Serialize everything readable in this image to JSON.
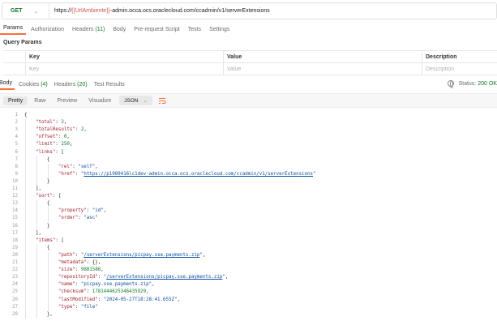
{
  "request": {
    "method": "GET",
    "url_prefix": "https://",
    "url_variable": "{{UrlAmbiente}}",
    "url_suffix": "-admin.occa.ocs.oraclecloud.com/ccadmin/v1/serverExtensions"
  },
  "request_tabs": [
    {
      "label": "Params",
      "active": true
    },
    {
      "label": "Authorization"
    },
    {
      "label": "Headers",
      "count": "(11)"
    },
    {
      "label": "Body"
    },
    {
      "label": "Pre-request Script"
    },
    {
      "label": "Tests"
    },
    {
      "label": "Settings"
    }
  ],
  "query_params": {
    "title": "Query Params",
    "headers": {
      "key": "Key",
      "value": "Value",
      "description": "Description"
    },
    "placeholders": {
      "key": "Key",
      "value": "Value",
      "description": "Description"
    }
  },
  "response_tabs": [
    {
      "label": "Body",
      "active": true
    },
    {
      "label": "Cookies",
      "count": "(4)"
    },
    {
      "label": "Headers",
      "count": "(20)"
    },
    {
      "label": "Test Results"
    }
  ],
  "status": {
    "label": "Status:",
    "code": "200 OK"
  },
  "view_buttons": [
    {
      "label": "Pretty",
      "active": true
    },
    {
      "label": "Raw"
    },
    {
      "label": "Preview"
    },
    {
      "label": "Visualize"
    }
  ],
  "format": "JSON",
  "code_lines": [
    [
      {
        "t": "{",
        "c": "p"
      }
    ],
    [
      {
        "t": "    ",
        "c": "p"
      },
      {
        "t": "\"total\"",
        "c": "k"
      },
      {
        "t": ": ",
        "c": "p"
      },
      {
        "t": "2",
        "c": "n"
      },
      {
        "t": ",",
        "c": "p"
      }
    ],
    [
      {
        "t": "    ",
        "c": "p"
      },
      {
        "t": "\"totalResults\"",
        "c": "k"
      },
      {
        "t": ": ",
        "c": "p"
      },
      {
        "t": "2",
        "c": "n"
      },
      {
        "t": ",",
        "c": "p"
      }
    ],
    [
      {
        "t": "    ",
        "c": "p"
      },
      {
        "t": "\"offset\"",
        "c": "k"
      },
      {
        "t": ": ",
        "c": "p"
      },
      {
        "t": "0",
        "c": "n"
      },
      {
        "t": ",",
        "c": "p"
      }
    ],
    [
      {
        "t": "    ",
        "c": "p"
      },
      {
        "t": "\"limit\"",
        "c": "k"
      },
      {
        "t": ": ",
        "c": "p"
      },
      {
        "t": "250",
        "c": "n"
      },
      {
        "t": ",",
        "c": "p"
      }
    ],
    [
      {
        "t": "    ",
        "c": "p"
      },
      {
        "t": "\"links\"",
        "c": "k"
      },
      {
        "t": ": [",
        "c": "p"
      }
    ],
    [
      {
        "t": "        {",
        "c": "p"
      }
    ],
    [
      {
        "t": "            ",
        "c": "p"
      },
      {
        "t": "\"rel\"",
        "c": "k"
      },
      {
        "t": ": ",
        "c": "p"
      },
      {
        "t": "\"self\"",
        "c": "s"
      },
      {
        "t": ",",
        "c": "p"
      }
    ],
    [
      {
        "t": "            ",
        "c": "p"
      },
      {
        "t": "\"href\"",
        "c": "k"
      },
      {
        "t": ": ",
        "c": "p"
      },
      {
        "t": "\"",
        "c": "s"
      },
      {
        "t": "https://p1989416lc1dev-admin.occa.ocs.oraclecloud.com/ccadmin/v1/serverExtensions",
        "c": "u"
      },
      {
        "t": "\"",
        "c": "s"
      }
    ],
    [
      {
        "t": "        }",
        "c": "p"
      }
    ],
    [
      {
        "t": "    ],",
        "c": "p"
      }
    ],
    [
      {
        "t": "    ",
        "c": "p"
      },
      {
        "t": "\"sort\"",
        "c": "k"
      },
      {
        "t": ": [",
        "c": "p"
      }
    ],
    [
      {
        "t": "        {",
        "c": "p"
      }
    ],
    [
      {
        "t": "            ",
        "c": "p"
      },
      {
        "t": "\"property\"",
        "c": "k"
      },
      {
        "t": ": ",
        "c": "p"
      },
      {
        "t": "\"id\"",
        "c": "s"
      },
      {
        "t": ",",
        "c": "p"
      }
    ],
    [
      {
        "t": "            ",
        "c": "p"
      },
      {
        "t": "\"order\"",
        "c": "k"
      },
      {
        "t": ": ",
        "c": "p"
      },
      {
        "t": "\"asc\"",
        "c": "s"
      }
    ],
    [
      {
        "t": "        }",
        "c": "p"
      }
    ],
    [
      {
        "t": "    ],",
        "c": "p"
      }
    ],
    [
      {
        "t": "    ",
        "c": "p"
      },
      {
        "t": "\"items\"",
        "c": "k"
      },
      {
        "t": ": [",
        "c": "p"
      }
    ],
    [
      {
        "t": "        {",
        "c": "p"
      }
    ],
    [
      {
        "t": "            ",
        "c": "p"
      },
      {
        "t": "\"path\"",
        "c": "k"
      },
      {
        "t": ": ",
        "c": "p"
      },
      {
        "t": "\"",
        "c": "s"
      },
      {
        "t": "/serverExtensions/picpay.sse.payments.zip",
        "c": "u"
      },
      {
        "t": "\"",
        "c": "s"
      },
      {
        "t": ",",
        "c": "p"
      }
    ],
    [
      {
        "t": "            ",
        "c": "p"
      },
      {
        "t": "\"metadata\"",
        "c": "k"
      },
      {
        "t": ": {},",
        "c": "p"
      }
    ],
    [
      {
        "t": "            ",
        "c": "p"
      },
      {
        "t": "\"size\"",
        "c": "k"
      },
      {
        "t": ": ",
        "c": "p"
      },
      {
        "t": "9881586",
        "c": "n"
      },
      {
        "t": ",",
        "c": "p"
      }
    ],
    [
      {
        "t": "            ",
        "c": "p"
      },
      {
        "t": "\"repositoryId\"",
        "c": "k"
      },
      {
        "t": ": ",
        "c": "p"
      },
      {
        "t": "\"",
        "c": "s"
      },
      {
        "t": "/serverExtensions/picpay.sse.payments.zip",
        "c": "u"
      },
      {
        "t": "\"",
        "c": "s"
      },
      {
        "t": ",",
        "c": "p"
      }
    ],
    [
      {
        "t": "            ",
        "c": "p"
      },
      {
        "t": "\"name\"",
        "c": "k"
      },
      {
        "t": ": ",
        "c": "p"
      },
      {
        "t": "\"picpay.sse.payments.zip\"",
        "c": "s"
      },
      {
        "t": ",",
        "c": "p"
      }
    ],
    [
      {
        "t": "            ",
        "c": "p"
      },
      {
        "t": "\"checksum\"",
        "c": "k"
      },
      {
        "t": ": ",
        "c": "p"
      },
      {
        "t": "1781444625346435929",
        "c": "n"
      },
      {
        "t": ",",
        "c": "p"
      }
    ],
    [
      {
        "t": "            ",
        "c": "p"
      },
      {
        "t": "\"lastModified\"",
        "c": "k"
      },
      {
        "t": ": ",
        "c": "p"
      },
      {
        "t": "\"2024-05-27T18:28:41.655Z\"",
        "c": "s"
      },
      {
        "t": ",",
        "c": "p"
      }
    ],
    [
      {
        "t": "            ",
        "c": "p"
      },
      {
        "t": "\"type\"",
        "c": "k"
      },
      {
        "t": ": ",
        "c": "p"
      },
      {
        "t": "\"file\"",
        "c": "s"
      }
    ],
    [
      {
        "t": "        },",
        "c": "p"
      }
    ]
  ]
}
